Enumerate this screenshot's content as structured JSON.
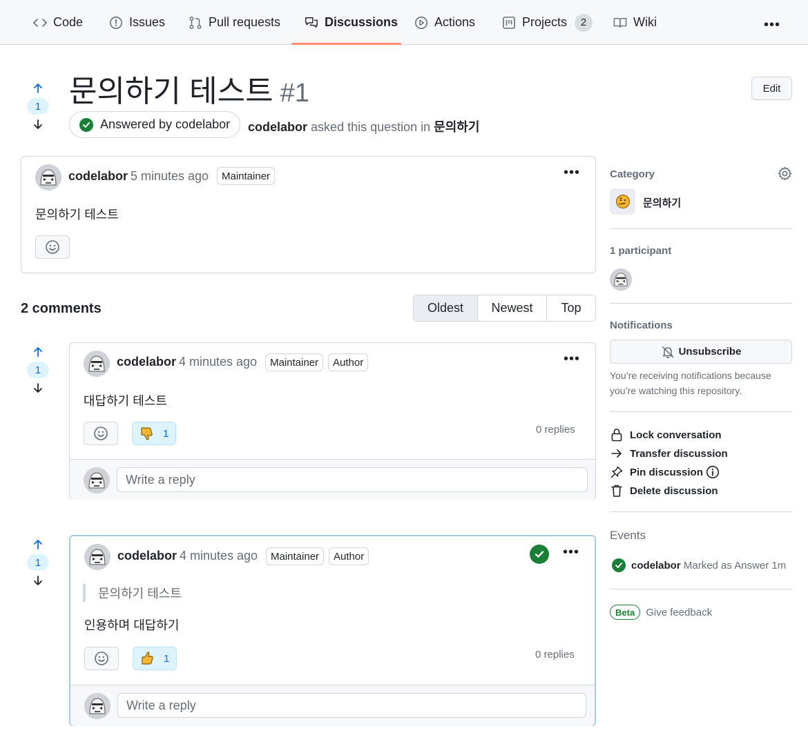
{
  "nav": {
    "tabs": [
      {
        "label": "Code",
        "icon": "code-icon"
      },
      {
        "label": "Issues",
        "icon": "issue-icon"
      },
      {
        "label": "Pull requests",
        "icon": "pull-request-icon"
      },
      {
        "label": "Discussions",
        "icon": "discussions-icon",
        "selected": true
      },
      {
        "label": "Actions",
        "icon": "play-icon"
      },
      {
        "label": "Projects",
        "icon": "project-icon",
        "counter": "2"
      },
      {
        "label": "Wiki",
        "icon": "book-icon"
      }
    ],
    "more": "•••"
  },
  "discussion": {
    "title": "문의하기 테스트",
    "number": "#1",
    "votes": "1",
    "edit_label": "Edit",
    "answered_label": "Answered by codelabor",
    "asker": "codelabor",
    "asked_text": "asked this question in",
    "category": "문의하기"
  },
  "original_post": {
    "author": "codelabor",
    "time": "5 minutes ago",
    "badges": [
      "Maintainer"
    ],
    "body": "문의하기 테스트",
    "more": "•••"
  },
  "comments_header": {
    "count_label": "2 comments",
    "sort_options": [
      "Oldest",
      "Newest",
      "Top"
    ],
    "active_sort": "Oldest"
  },
  "comments": [
    {
      "votes": "1",
      "author": "codelabor",
      "time": "4 minutes ago",
      "badges": [
        "Maintainer",
        "Author"
      ],
      "body": "대답하기 테스트",
      "reaction": {
        "emoji": "thumbs-down",
        "count": "1"
      },
      "replies": "0 replies",
      "reply_placeholder": "Write a reply",
      "more": "•••"
    },
    {
      "votes": "1",
      "author": "codelabor",
      "time": "4 minutes ago",
      "badges": [
        "Maintainer",
        "Author"
      ],
      "quote": "문의하기 테스트",
      "body": "인용하며 대답하기",
      "reaction": {
        "emoji": "thumbs-up",
        "count": "1"
      },
      "replies": "0 replies",
      "reply_placeholder": "Write a reply",
      "is_answer": true,
      "more": "•••"
    }
  ],
  "sidebar": {
    "category_heading": "Category",
    "category_name": "문의하기",
    "participants_heading": "1 participant",
    "notifications_heading": "Notifications",
    "unsubscribe_label": "Unsubscribe",
    "notification_reason": [
      "You’re receiving notifications because",
      "you’re watching this repository."
    ],
    "actions": [
      {
        "label": "Lock conversation",
        "icon": "lock-icon"
      },
      {
        "label": "Transfer discussion",
        "icon": "arrow-right-icon"
      },
      {
        "label": "Pin discussion",
        "icon": "pin-icon"
      },
      {
        "label": "Delete discussion",
        "icon": "trash-icon"
      }
    ],
    "events_heading": "Events",
    "event": {
      "actor": "codelabor",
      "text": "Marked as Answer",
      "time": "1m"
    },
    "beta_label": "Beta",
    "feedback_label": "Give feedback"
  },
  "colors": {
    "accent": "#0969da",
    "success": "#1a7f37",
    "tab_underline": "#fd8c73"
  }
}
